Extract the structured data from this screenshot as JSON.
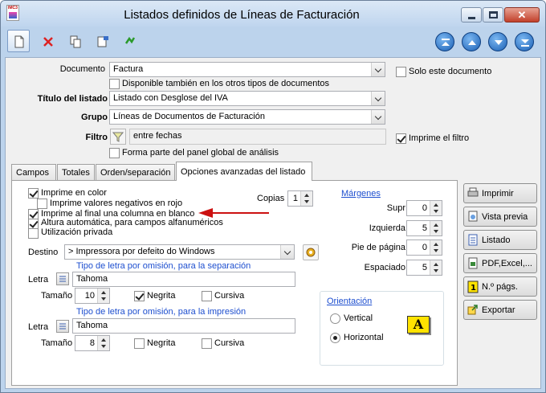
{
  "window": {
    "title": "Listados definidos de  Líneas de Facturación",
    "app_icon_tag": "IMC3",
    "close_glyph": "✕"
  },
  "toolbar": {
    "buttons": [
      "new-document-icon",
      "delete-x-icon",
      "copy-icon",
      "properties-icon",
      "refresh-icon"
    ],
    "nav_buttons": [
      "first-record-icon",
      "previous-record-icon",
      "next-record-icon",
      "last-record-icon"
    ]
  },
  "form": {
    "documento": {
      "label": "Documento",
      "value": "Factura"
    },
    "solo_este": {
      "label": "Solo este documento",
      "checked": false
    },
    "disponible": {
      "label": "Disponible también en los otros tipos de documentos",
      "checked": false
    },
    "titulo": {
      "label": "Título del listado",
      "value": "Listado con Desglose del IVA"
    },
    "grupo": {
      "label": "Grupo",
      "value": "Líneas de Documentos de Facturación"
    },
    "filtro": {
      "label": "Filtro",
      "value": "entre fechas"
    },
    "imprime_filtro": {
      "label": "Imprime el filtro",
      "checked": true
    },
    "panel_global": {
      "label": "Forma parte del panel global de análisis",
      "checked": false
    }
  },
  "tabs": [
    {
      "label": "Campos",
      "selected": false
    },
    {
      "label": "Totales",
      "selected": false
    },
    {
      "label": "Orden/separación",
      "selected": false
    },
    {
      "label": "Opciones avanzadas del listado",
      "selected": true
    }
  ],
  "options": {
    "imprime_color": {
      "label": "Imprime en color",
      "checked": true
    },
    "negativos_rojo": {
      "label": "Imprime valores negativos en rojo",
      "checked": false
    },
    "columna_blanco": {
      "label": "Imprime al final una columna en blanco",
      "checked": true
    },
    "altura_auto": {
      "label": "Altura automática, para campos alfanuméricos",
      "checked": true
    },
    "privada": {
      "label": "Utilización privada",
      "checked": false
    },
    "copias": {
      "label": "Copias",
      "value": "1"
    }
  },
  "margins": {
    "title": "Márgenes",
    "superior": {
      "label": "Supr",
      "value": "0"
    },
    "izquierda": {
      "label": "Izquierda",
      "value": "5"
    },
    "pie": {
      "label": "Pie de página",
      "value": "0"
    },
    "espaciado": {
      "label": "Espaciado",
      "value": "5"
    }
  },
  "destino": {
    "label": "Destino",
    "value": "> Impressora por defeito do Windows"
  },
  "font_sep": {
    "caption": "Tipo de letra por omisión, para la separación",
    "letra_label": "Letra",
    "letra": "Tahoma",
    "tamano_label": "Tamaño",
    "tamano": "10",
    "negrita": {
      "label": "Negrita",
      "checked": true
    },
    "cursiva": {
      "label": "Cursiva",
      "checked": false
    }
  },
  "font_imp": {
    "caption": "Tipo de letra por omisión, para la impresión",
    "letra_label": "Letra",
    "letra": "Tahoma",
    "tamano_label": "Tamaño",
    "tamano": "8",
    "negrita": {
      "label": "Negrita",
      "checked": false
    },
    "cursiva": {
      "label": "Cursiva",
      "checked": false
    }
  },
  "orientation": {
    "title": "Orientación",
    "vertical": {
      "label": "Vertical",
      "selected": false
    },
    "horizontal": {
      "label": "Horizontal",
      "selected": true
    },
    "preview_letter": "A"
  },
  "side_buttons": [
    "Imprimir",
    "Vista previa",
    "Listado",
    "PDF,Excel,...",
    "N.º págs.",
    "Exportar"
  ],
  "colors": {
    "arrow": "#cc1111",
    "link_blue": "#1e4fcf",
    "title_bar": "#c5d9f0"
  }
}
